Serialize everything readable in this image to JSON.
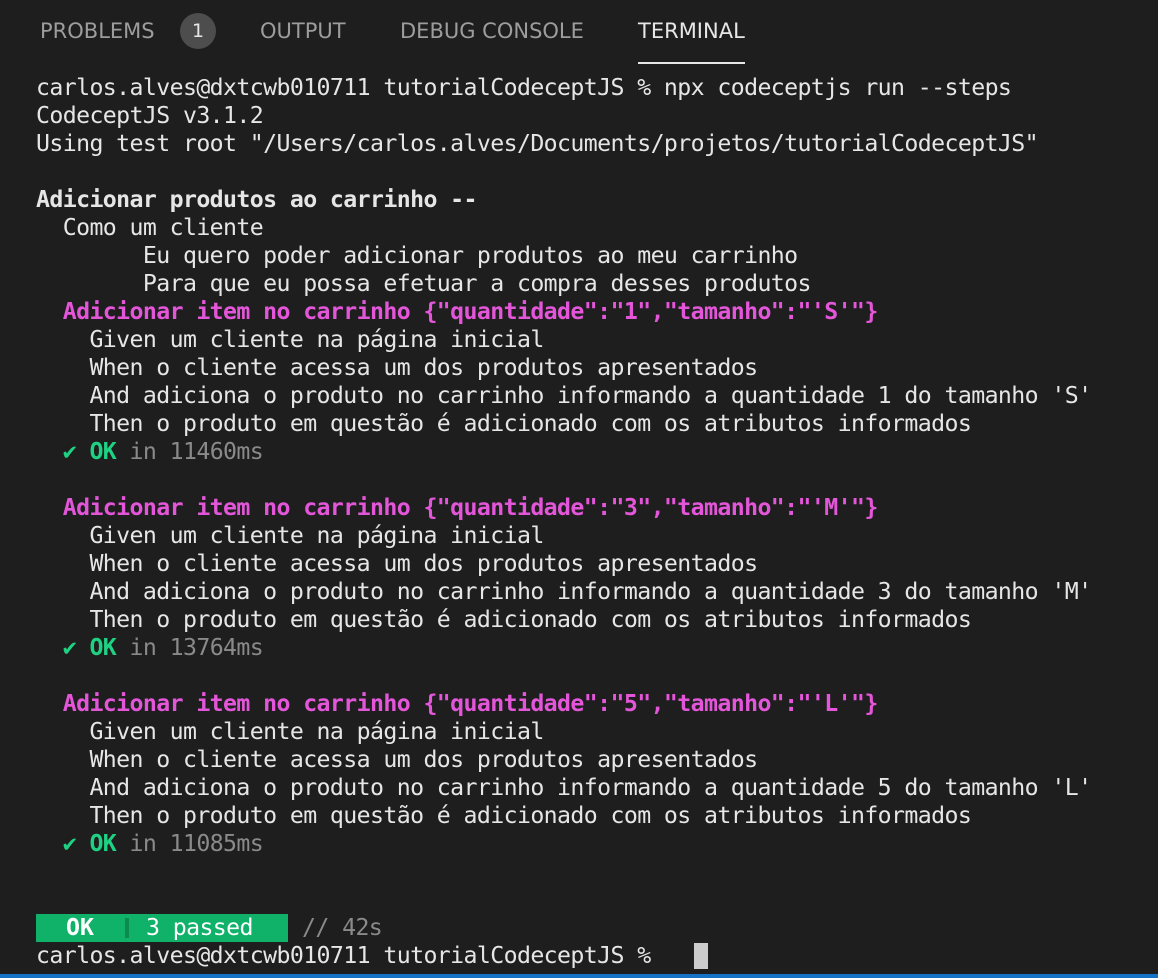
{
  "tabs": {
    "problems": "PROBLEMS",
    "problems_count": "1",
    "output": "OUTPUT",
    "debug_console": "DEBUG CONSOLE",
    "terminal": "TERMINAL",
    "active": "terminal"
  },
  "terminal": {
    "command_line": "carlos.alves@dxtcwb010711 tutorialCodeceptJS % npx codeceptjs run --steps",
    "version": "CodeceptJS v3.1.2",
    "test_root": "Using test root \"/Users/carlos.alves/Documents/projetos/tutorialCodeceptJS\"",
    "feature_title": "Adicionar produtos ao carrinho --",
    "feature_desc": [
      "  Como um cliente",
      "        Eu quero poder adicionar produtos ao meu carrinho",
      "        Para que eu possa efetuar a compra desses produtos"
    ],
    "scenarios": [
      {
        "title": "  Adicionar item no carrinho {\"quantidade\":\"1\",\"tamanho\":\"'S'\"}",
        "steps": [
          "    Given um cliente na página inicial",
          "    When o cliente acessa um dos produtos apresentados",
          "    And adiciona o produto no carrinho informando a quantidade 1 do tamanho 'S'",
          "    Then o produto em questão é adicionado com os atributos informados"
        ],
        "result": "  ✔ OK",
        "duration": " in 11460ms"
      },
      {
        "title": "  Adicionar item no carrinho {\"quantidade\":\"3\",\"tamanho\":\"'M'\"}",
        "steps": [
          "    Given um cliente na página inicial",
          "    When o cliente acessa um dos produtos apresentados",
          "    And adiciona o produto no carrinho informando a quantidade 3 do tamanho 'M'",
          "    Then o produto em questão é adicionado com os atributos informados"
        ],
        "result": "  ✔ OK",
        "duration": " in 13764ms"
      },
      {
        "title": "  Adicionar item no carrinho {\"quantidade\":\"5\",\"tamanho\":\"'L'\"}",
        "steps": [
          "    Given um cliente na página inicial",
          "    When o cliente acessa um dos produtos apresentados",
          "    And adiciona o produto no carrinho informando a quantidade 5 do tamanho 'L'",
          "    Then o produto em questão é adicionado com os atributos informados"
        ],
        "result": "  ✔ OK",
        "duration": " in 11085ms"
      }
    ],
    "summary": {
      "status": "OK",
      "passed": "3 passed",
      "time": "// 42s"
    },
    "prompt": "carlos.alves@dxtcwb010711 tutorialCodeceptJS % "
  },
  "colors": {
    "background": "#1e1e1e",
    "scenario_title": "#e456d9",
    "ok_green": "#1fd182",
    "summary_bar": "#10b26a",
    "status_strip": "#1473c6"
  }
}
